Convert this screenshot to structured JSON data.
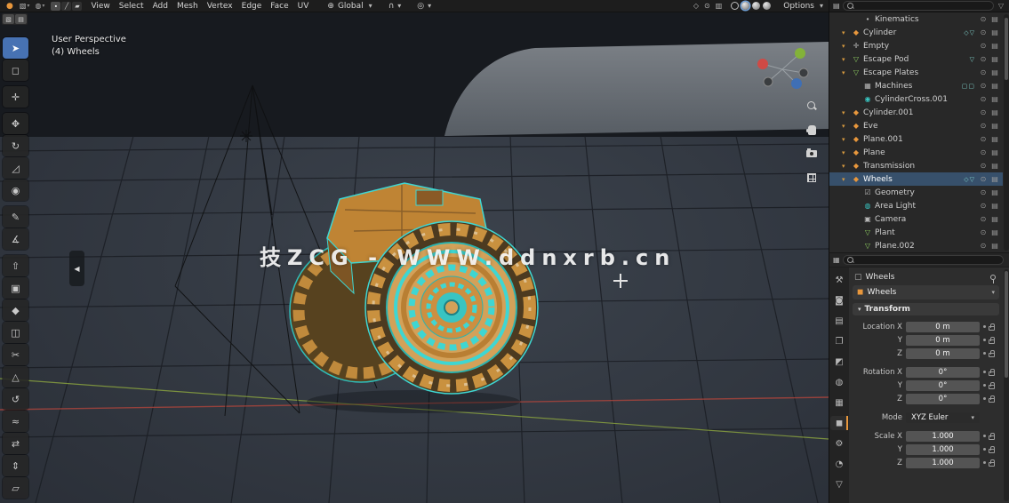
{
  "colors": {
    "accent_blue": "#4772b3",
    "selection_cyan": "#3fd6d2",
    "object_orange": "#c98a3b",
    "axis_x_red": "#a8443c",
    "axis_y_green": "#8ea83f",
    "selected_row_blue": "#37506b"
  },
  "icons": {
    "blender_logo": "●",
    "editor_type_icon": "▧",
    "mode_icon": "◍",
    "vertex_select_icon": "∙",
    "edge_select_icon": "╱",
    "face_select_icon": "▰",
    "orientation_icon": "⊕",
    "snap_magnet_icon": "∩",
    "proportional_icon": "◎",
    "gizmo_toggle_icon": "◇",
    "overlays_toggle_icon": "⊙",
    "xray_toggle_icon": "▥",
    "caret": "▾",
    "filter_icon": "▽",
    "outliner_editor_icon": "▤",
    "props_editor_icon": "▦",
    "eye_icon": "⊙",
    "render_toggle_icon": "▤",
    "object_box_icon": "▢",
    "object_box_icon_orange": "◼",
    "collapse_arrow": "◀",
    "search_icon": "css-magnifier",
    "pin_icon": "css-pin",
    "lock_icon": "css-lock",
    "zoom_icon": "css-magnifier",
    "pan_hand_icon": "css-hand",
    "camera_view_icon": "css-camera",
    "ortho_grid_icon": "css-grid"
  },
  "topbar": {
    "menus": [
      {
        "label": "View"
      },
      {
        "label": "Select"
      },
      {
        "label": "Add"
      },
      {
        "label": "Mesh"
      },
      {
        "label": "Vertex"
      },
      {
        "label": "Edge"
      },
      {
        "label": "Face"
      },
      {
        "label": "UV"
      }
    ],
    "orientation_label": "Global",
    "options_label": "Options"
  },
  "viewport": {
    "mode_line": "User Perspective",
    "object_line": "(4) Wheels",
    "watermark": "技ZCG - WWW.ddnxrb.cn"
  },
  "toolbar": {
    "tools": [
      {
        "name": "tweak-select",
        "glyph": "➤",
        "cls": "active"
      },
      {
        "name": "select-box",
        "glyph": "◻",
        "cls": ""
      },
      {
        "name": "cursor",
        "glyph": "✛",
        "cls": "gap"
      },
      {
        "name": "move",
        "glyph": "✥",
        "cls": "gap"
      },
      {
        "name": "rotate",
        "glyph": "↻",
        "cls": ""
      },
      {
        "name": "scale",
        "glyph": "◿",
        "cls": ""
      },
      {
        "name": "transform",
        "glyph": "◉",
        "cls": ""
      },
      {
        "name": "annotate",
        "glyph": "✎",
        "cls": "gap"
      },
      {
        "name": "measure",
        "glyph": "∡",
        "cls": ""
      },
      {
        "name": "extrude-region",
        "glyph": "⇧",
        "cls": "gap"
      },
      {
        "name": "inset-faces",
        "glyph": "▣",
        "cls": ""
      },
      {
        "name": "bevel",
        "glyph": "◆",
        "cls": ""
      },
      {
        "name": "loop-cut",
        "glyph": "◫",
        "cls": ""
      },
      {
        "name": "knife",
        "glyph": "✂",
        "cls": ""
      },
      {
        "name": "poly-build",
        "glyph": "△",
        "cls": ""
      },
      {
        "name": "spin",
        "glyph": "↺",
        "cls": ""
      },
      {
        "name": "smooth",
        "glyph": "≈",
        "cls": ""
      },
      {
        "name": "edge-slide",
        "glyph": "⇄",
        "cls": ""
      },
      {
        "name": "shrink-fatten",
        "glyph": "⇕",
        "cls": ""
      },
      {
        "name": "shear",
        "glyph": "▱",
        "cls": ""
      }
    ]
  },
  "outliner": {
    "items": [
      {
        "cls": "d2",
        "ex": "",
        "icon": "∙",
        "iconc": "c-gray",
        "label": "Kinematics",
        "badge": ""
      },
      {
        "cls": "d1",
        "ex": "▾",
        "icon": "◆",
        "iconc": "c-orange",
        "label": "Cylinder",
        "badge": "◇▽"
      },
      {
        "cls": "d1",
        "ex": "▾",
        "icon": "✛",
        "iconc": "c-gray",
        "label": "Empty",
        "badge": ""
      },
      {
        "cls": "d1",
        "ex": "▾",
        "icon": "▽",
        "iconc": "c-green",
        "label": "Escape Pod",
        "badge": "▽"
      },
      {
        "cls": "d1",
        "ex": "▾",
        "icon": "▽",
        "iconc": "c-green",
        "label": "Escape Plates",
        "badge": ""
      },
      {
        "cls": "d2",
        "ex": "",
        "icon": "▦",
        "iconc": "c-gray",
        "label": "Machines",
        "badge": "▢▢"
      },
      {
        "cls": "d2",
        "ex": "",
        "icon": "◉",
        "iconc": "c-teal",
        "label": "CylinderCross.001",
        "badge": ""
      },
      {
        "cls": "d1",
        "ex": "▾",
        "icon": "◆",
        "iconc": "c-orange",
        "label": "Cylinder.001",
        "badge": ""
      },
      {
        "cls": "d1",
        "ex": "▾",
        "icon": "◆",
        "iconc": "c-orange",
        "label": "Eve",
        "badge": ""
      },
      {
        "cls": "d1",
        "ex": "▾",
        "icon": "◆",
        "iconc": "c-orange",
        "label": "Plane.001",
        "badge": ""
      },
      {
        "cls": "d1",
        "ex": "▾",
        "icon": "◆",
        "iconc": "c-orange",
        "label": "Plane",
        "badge": ""
      },
      {
        "cls": "d1",
        "ex": "▾",
        "icon": "◆",
        "iconc": "c-orange",
        "label": "Transmission",
        "badge": ""
      },
      {
        "cls": "d1 selected",
        "ex": "▾",
        "icon": "◆",
        "iconc": "c-orange",
        "label": "Wheels",
        "badge": "◇▽"
      },
      {
        "cls": "d2",
        "ex": "",
        "icon": "☑",
        "iconc": "c-gray",
        "label": "Geometry",
        "badge": ""
      },
      {
        "cls": "d2",
        "ex": "",
        "icon": "◍",
        "iconc": "c-teal",
        "label": "Area Light",
        "badge": ""
      },
      {
        "cls": "d2",
        "ex": "",
        "icon": "▣",
        "iconc": "c-gray",
        "label": "Camera",
        "badge": ""
      },
      {
        "cls": "d2",
        "ex": "",
        "icon": "▽",
        "iconc": "c-green",
        "label": "Plant",
        "badge": ""
      },
      {
        "cls": "d2",
        "ex": "",
        "icon": "▽",
        "iconc": "c-green",
        "label": "Plane.002",
        "badge": ""
      }
    ]
  },
  "properties": {
    "tabs": [
      {
        "name": "tool",
        "glyph": "⚒",
        "iconc": "c-gray",
        "cls": ""
      },
      {
        "name": "render",
        "glyph": "◙",
        "iconc": "c-gray",
        "cls": ""
      },
      {
        "name": "output",
        "glyph": "▤",
        "iconc": "c-gray",
        "cls": ""
      },
      {
        "name": "view-layer",
        "glyph": "❐",
        "iconc": "c-gray",
        "cls": ""
      },
      {
        "name": "scene",
        "glyph": "◩",
        "iconc": "c-gray",
        "cls": ""
      },
      {
        "name": "world",
        "glyph": "◍",
        "iconc": "c-gray",
        "cls": ""
      },
      {
        "name": "collection",
        "glyph": "▦",
        "iconc": "c-gray",
        "cls": ""
      },
      {
        "name": "object",
        "glyph": "◼",
        "iconc": "c-orange",
        "cls": "active"
      },
      {
        "name": "modifiers",
        "glyph": "⚙",
        "iconc": "c-blue",
        "cls": ""
      },
      {
        "name": "physics",
        "glyph": "◔",
        "iconc": "c-orange",
        "cls": ""
      },
      {
        "name": "object-data",
        "glyph": "▽",
        "iconc": "c-green",
        "cls": ""
      }
    ],
    "object_name": "Wheels",
    "breadcrumb": "Wheels",
    "transform_title": "Transform",
    "fields": [
      {
        "label": "Location X",
        "value": "0 m",
        "cls": ""
      },
      {
        "label": "Y",
        "value": "0 m",
        "cls": ""
      },
      {
        "label": "Z",
        "value": "0 m",
        "cls": ""
      },
      {
        "label": "Rotation X",
        "value": "0°",
        "cls": "gap"
      },
      {
        "label": "Y",
        "value": "0°",
        "cls": ""
      },
      {
        "label": "Z",
        "value": "0°",
        "cls": ""
      },
      {
        "label": "Mode",
        "value": "XYZ Euler",
        "cls": "gap dropdown"
      },
      {
        "label": "Scale X",
        "value": "1.000",
        "cls": "gap"
      },
      {
        "label": "Y",
        "value": "1.000",
        "cls": ""
      },
      {
        "label": "Z",
        "value": "1.000",
        "cls": ""
      }
    ]
  }
}
